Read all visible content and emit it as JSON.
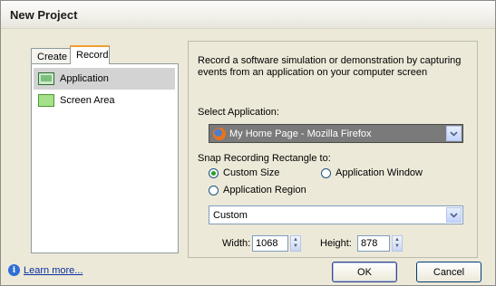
{
  "window": {
    "title": "New Project"
  },
  "tabs": [
    {
      "label": "Create"
    },
    {
      "label": "Record"
    }
  ],
  "list": [
    {
      "label": "Application",
      "icon": "application-window-icon",
      "selected": true
    },
    {
      "label": "Screen Area",
      "icon": "screen-area-icon",
      "selected": false
    }
  ],
  "main": {
    "description": "Record a software simulation or demonstration by capturing events from an application on your computer screen",
    "select_application_label": "Select Application:",
    "selected_application": "My Home Page - Mozilla Firefox",
    "snap_label": "Snap Recording Rectangle to:",
    "radio_custom_size": "Custom Size",
    "radio_application_window": "Application Window",
    "radio_application_region": "Application Region",
    "size_preset": "Custom",
    "width_label": "Width:",
    "width_value": "1068",
    "height_label": "Height:",
    "height_value": "878"
  },
  "footer": {
    "learn_more": "Learn more...",
    "ok_label": "OK",
    "cancel_label": "Cancel"
  }
}
